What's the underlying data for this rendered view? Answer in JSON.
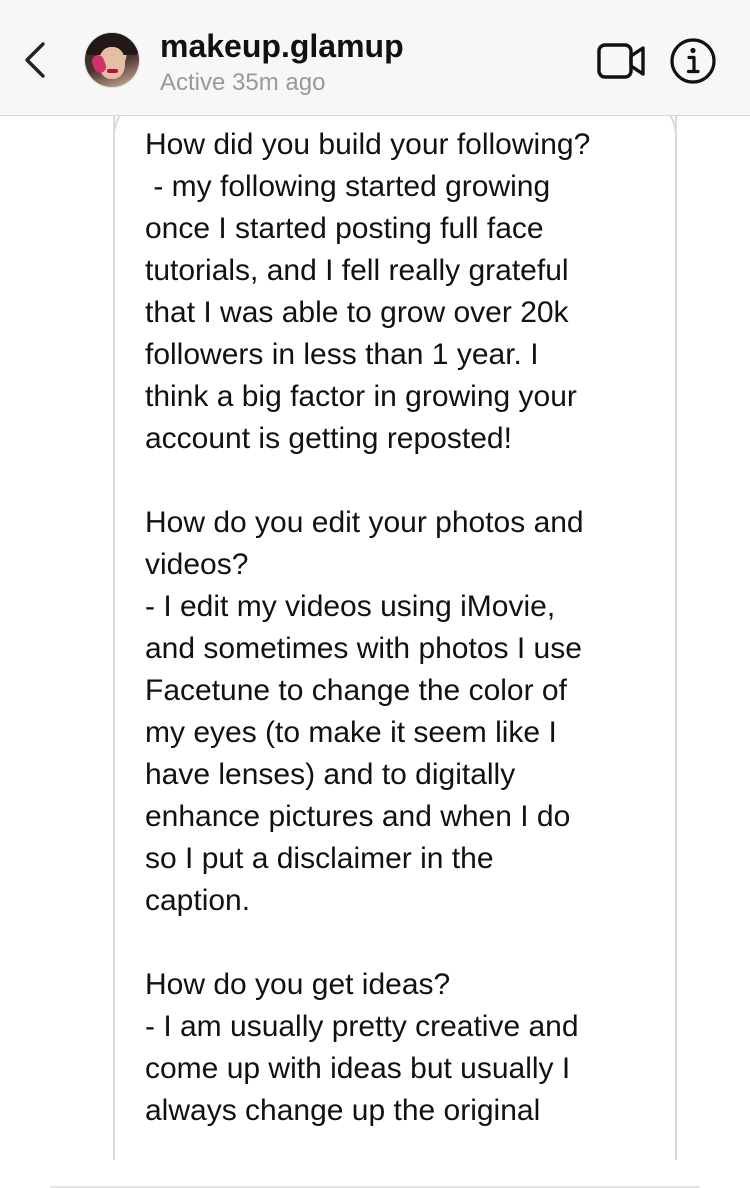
{
  "header": {
    "username": "makeup.glamup",
    "status": "Active 35m ago",
    "back_icon": "chevron-left-icon",
    "video_icon": "video-camera-icon",
    "info_icon": "info-icon"
  },
  "message": {
    "text": "How did you build your following?\n - my following started growing\nonce I started posting full face\ntutorials, and I fell really grateful\nthat I was able to grow over 20k\nfollowers in less than 1 year. I\nthink a big factor in growing your\naccount is getting reposted!\n\nHow do you edit your photos and\nvideos?\n- I edit my videos using iMovie,\nand sometimes with photos I use\nFacetune to change the color of\nmy eyes (to make it seem like I\nhave lenses) and to digitally\nenhance pictures and when I do\nso I put a disclaimer in the\ncaption.\n\nHow do you get ideas?\n- I am usually pretty creative and\ncome up with ideas but usually I\nalways change up the original"
  },
  "colors": {
    "header_bg": "#f7f7f7",
    "status_text": "#999999",
    "bubble_border": "#dadada",
    "text": "#111111"
  }
}
